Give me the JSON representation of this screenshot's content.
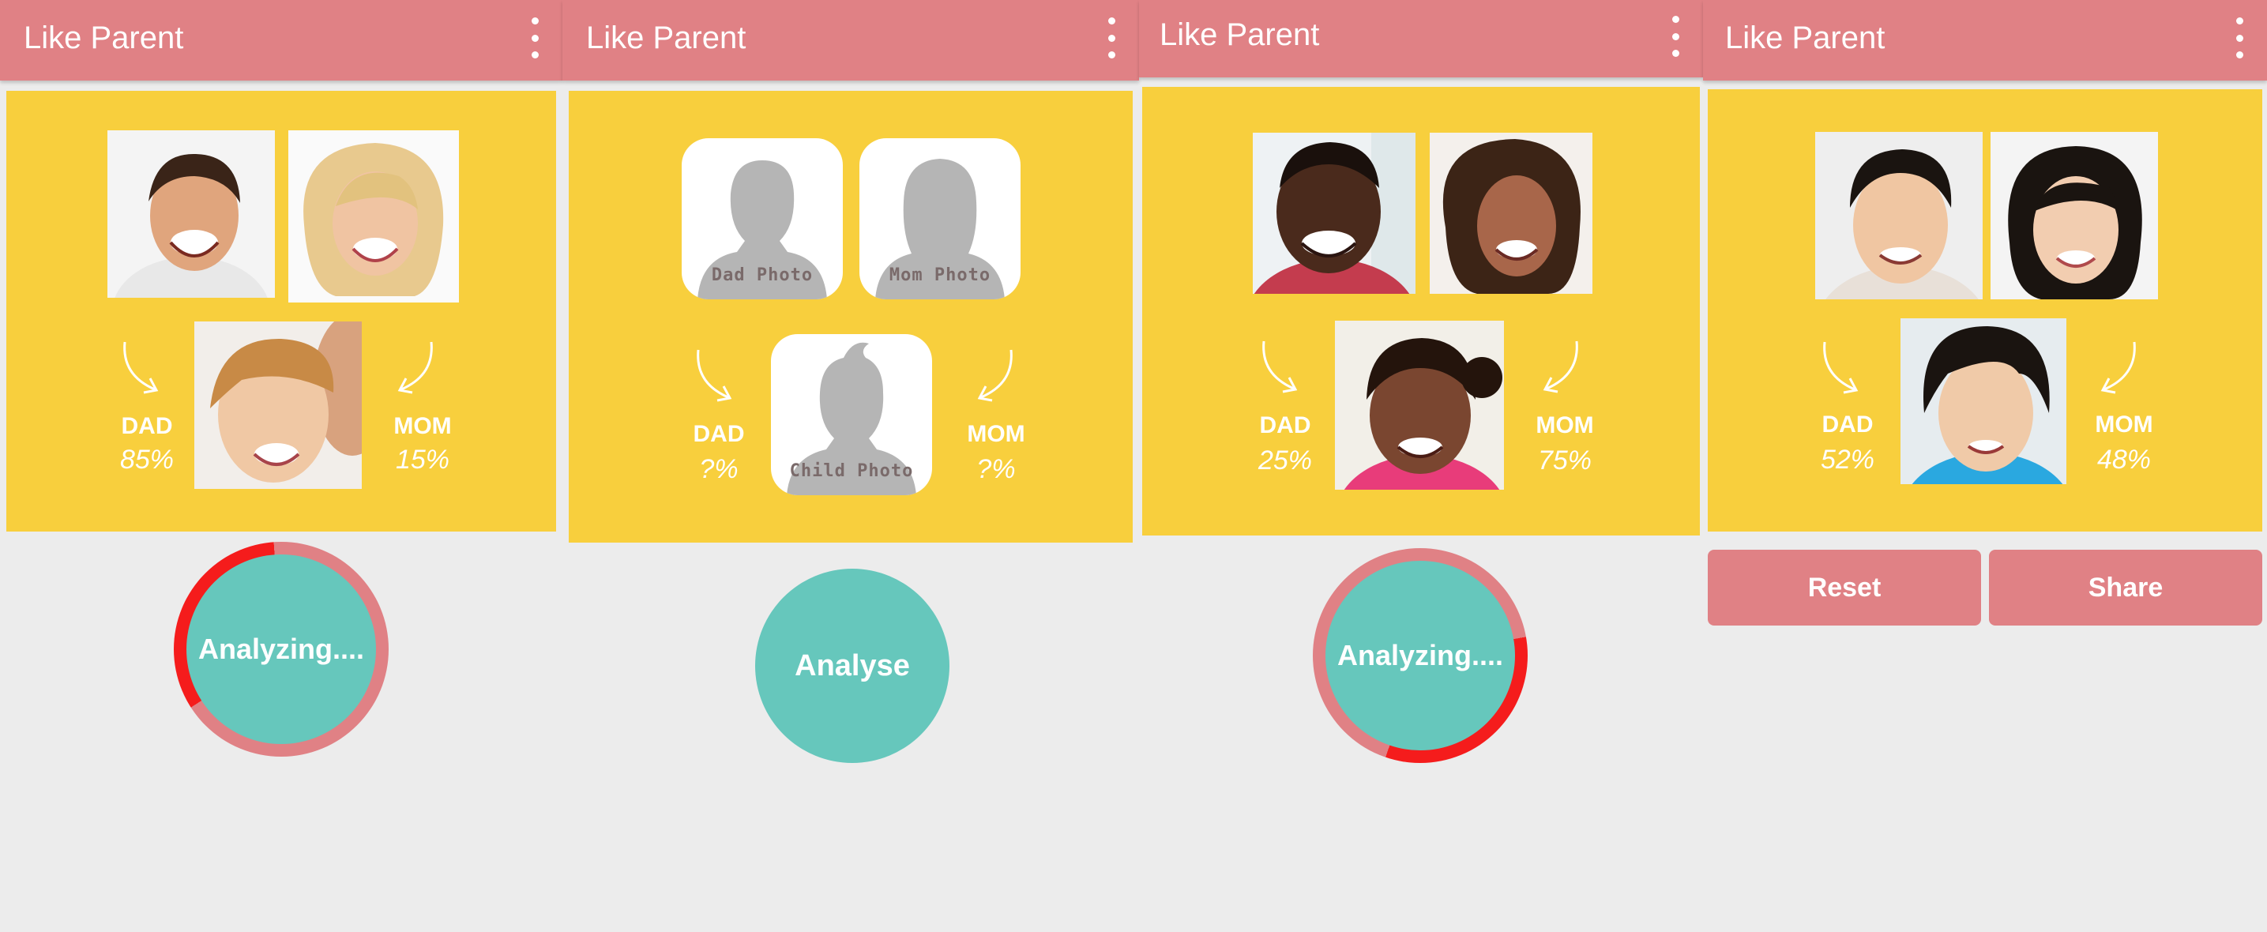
{
  "app": {
    "title": "Like Parent"
  },
  "colors": {
    "app_bar": "#e08185",
    "card": "#f8cf3d",
    "button": "#66c7bc",
    "progress": "#f51c1c",
    "ring_track": "#e08185",
    "background": "#ececec"
  },
  "icons": {
    "menu": "overflow-menu-icon",
    "arrow_dad": "curved-arrow-right-icon",
    "arrow_mom": "curved-arrow-left-icon"
  },
  "screens": [
    {
      "title": "Like Parent",
      "dad_label": "DAD",
      "mom_label": "MOM",
      "dad_value": "85%",
      "mom_value": "15%",
      "button_label": "Analyzing....",
      "progress": 0.33
    },
    {
      "title": "Like Parent",
      "dad_label": "DAD",
      "mom_label": "MOM",
      "dad_value": "?%",
      "mom_value": "?%",
      "dad_photo_label": "Dad Photo",
      "mom_photo_label": "Mom Photo",
      "child_photo_label": "Child Photo",
      "button_label": "Analyse"
    },
    {
      "title": "Like Parent",
      "dad_label": "DAD",
      "mom_label": "MOM",
      "dad_value": "25%",
      "mom_value": "75%",
      "button_label": "Analyzing....",
      "progress": 0.33
    },
    {
      "title": "Like Parent",
      "dad_label": "DAD",
      "mom_label": "MOM",
      "dad_value": "52%",
      "mom_value": "48%",
      "reset_label": "Reset",
      "share_label": "Share"
    }
  ]
}
